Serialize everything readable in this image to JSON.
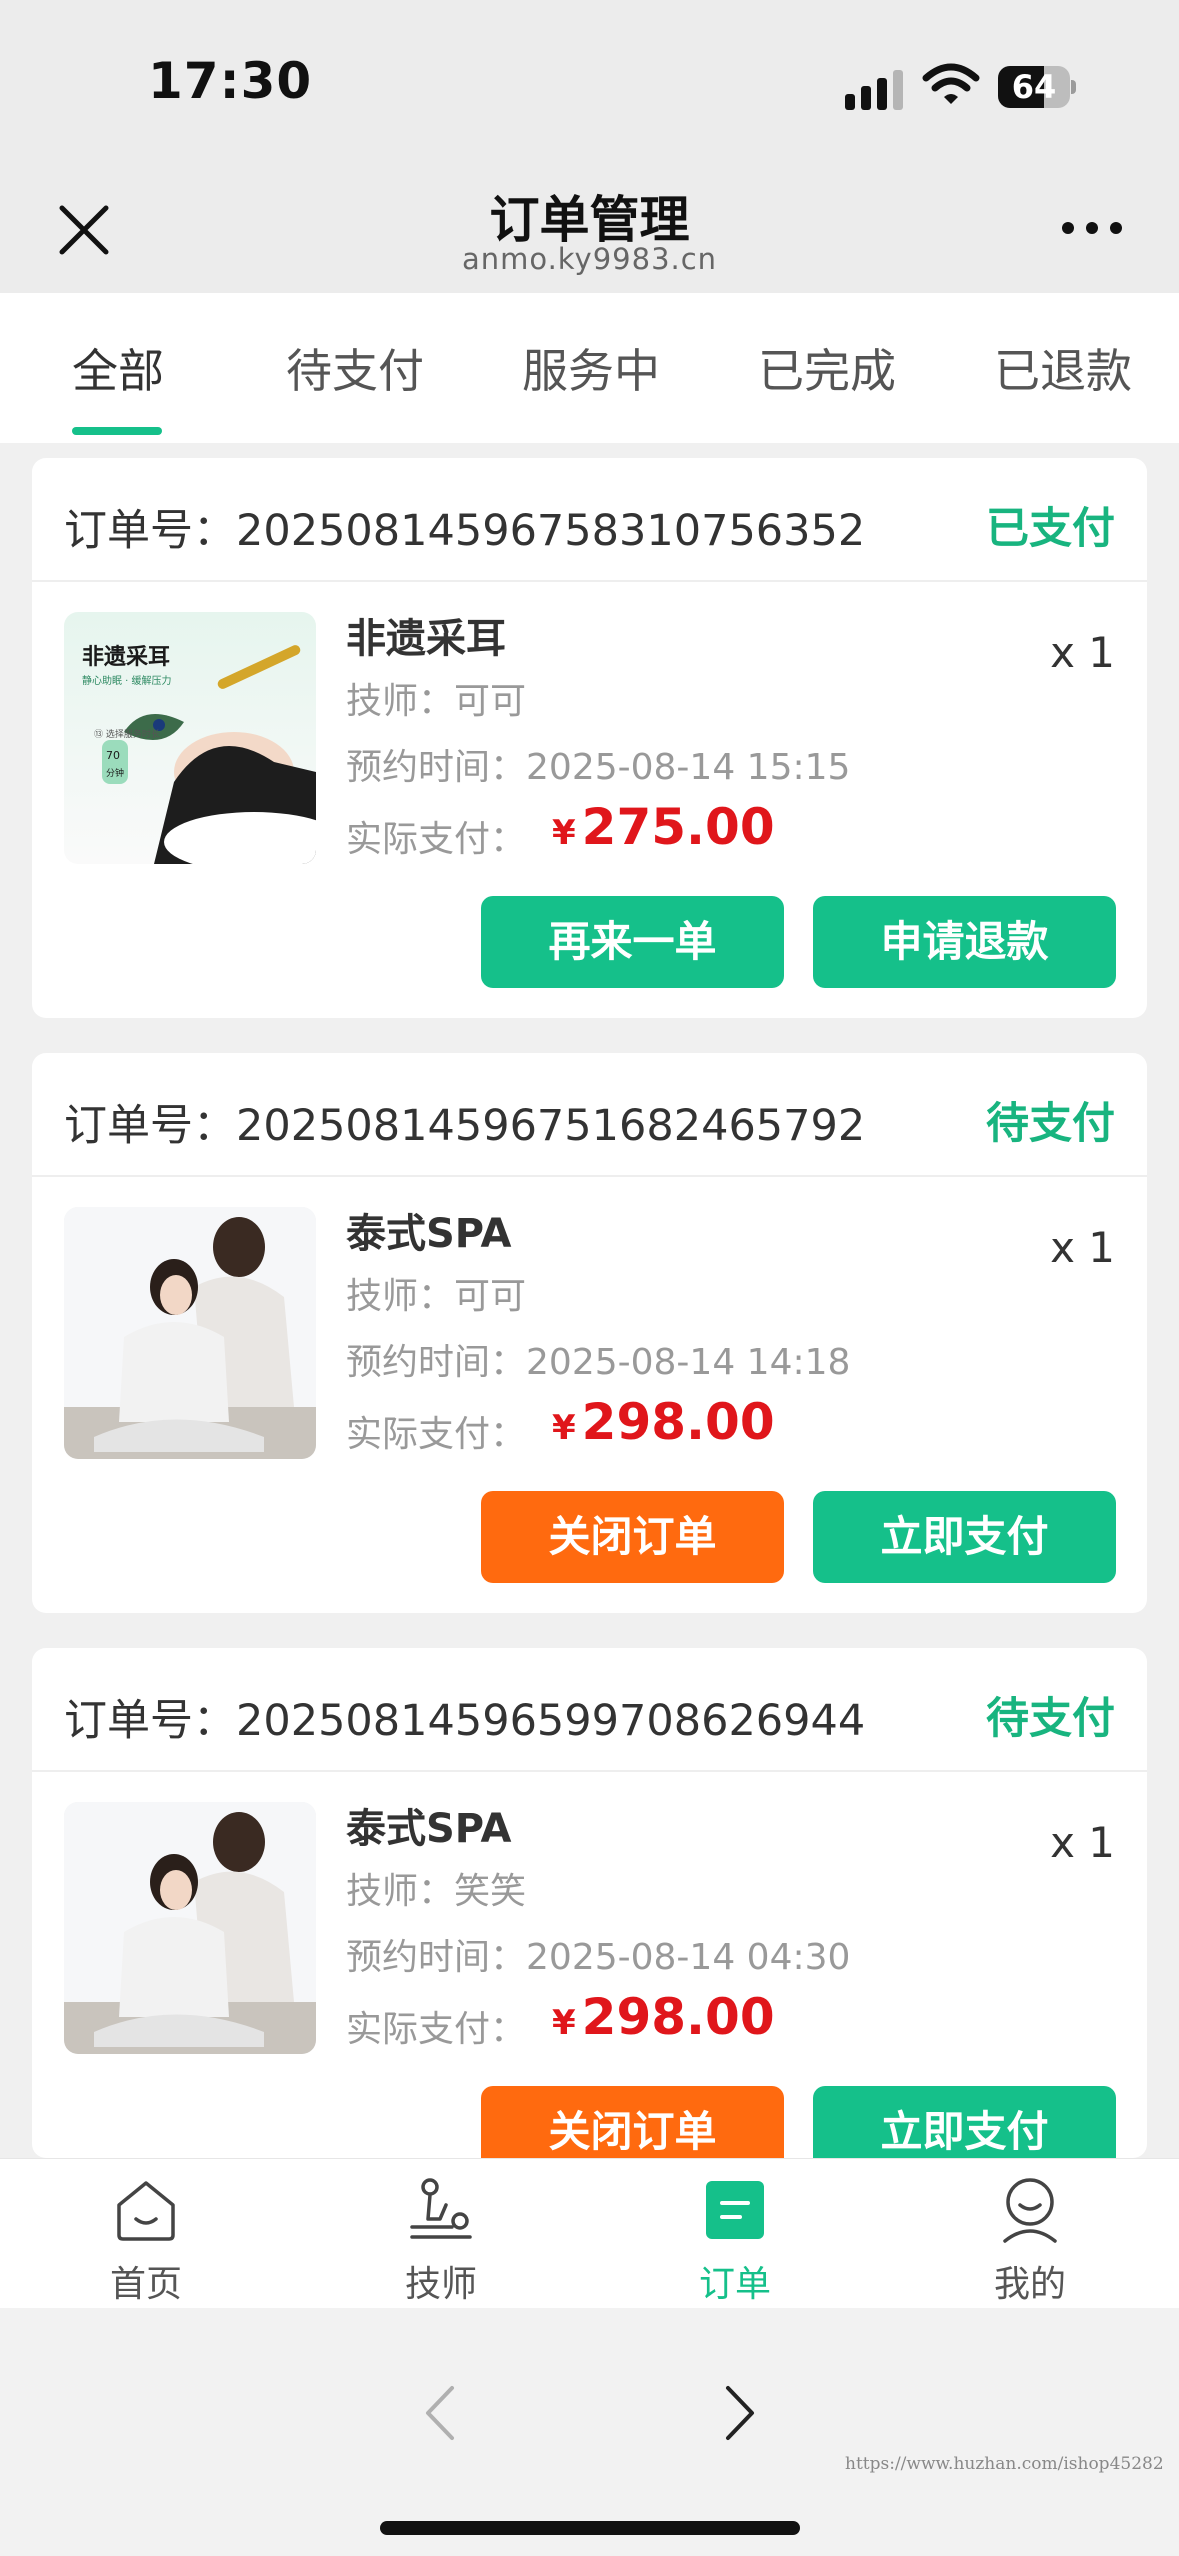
{
  "status_bar": {
    "time": "17:30",
    "battery": "64",
    "battery_level": 0.64
  },
  "header": {
    "title": "订单管理",
    "subtitle": "anmo.ky9983.cn"
  },
  "tabs": [
    {
      "label": "全部",
      "active": true
    },
    {
      "label": "待支付",
      "active": false
    },
    {
      "label": "服务中",
      "active": false
    },
    {
      "label": "已完成",
      "active": false
    },
    {
      "label": "已退款",
      "active": false
    }
  ],
  "orders": [
    {
      "order_label": "订单号：",
      "order_no": "20250814596758310756352",
      "status": "已支付",
      "service": "非遗采耳",
      "qty": "x 1",
      "tech_label": "技师：",
      "tech": "可可",
      "appt_label": "预约时间：",
      "appt_time": "2025-08-14 15:15",
      "paid_label": "实际支付：",
      "currency": "¥",
      "price": "275.00",
      "thumb_text": {
        "title": "非遗采耳",
        "tagline": "静心助眠 · 缓解压力",
        "side": "⑬ 选择服务时长",
        "badge_num": "70",
        "badge_unit": "分钟"
      },
      "buttons": [
        {
          "label": "再来一单",
          "style": "green"
        },
        {
          "label": "申请退款",
          "style": "green"
        }
      ]
    },
    {
      "order_label": "订单号：",
      "order_no": "20250814596751682465792",
      "status": "待支付",
      "service": "泰式SPA",
      "qty": "x 1",
      "tech_label": "技师：",
      "tech": "可可",
      "appt_label": "预约时间：",
      "appt_time": "2025-08-14 14:18",
      "paid_label": "实际支付：",
      "currency": "¥",
      "price": "298.00",
      "buttons": [
        {
          "label": "关闭订单",
          "style": "orange"
        },
        {
          "label": "立即支付",
          "style": "green"
        }
      ]
    },
    {
      "order_label": "订单号：",
      "order_no": "20250814596599708626944",
      "status": "待支付",
      "service": "泰式SPA",
      "qty": "x 1",
      "tech_label": "技师：",
      "tech": "笑笑",
      "appt_label": "预约时间：",
      "appt_time": "2025-08-14 04:30",
      "paid_label": "实际支付：",
      "currency": "¥",
      "price": "298.00",
      "buttons": [
        {
          "label": "关闭订单",
          "style": "orange"
        },
        {
          "label": "立即支付",
          "style": "green"
        }
      ]
    }
  ],
  "bottom_nav": [
    {
      "label": "首页",
      "icon": "home-icon",
      "active": false
    },
    {
      "label": "技师",
      "icon": "technician-icon",
      "active": false
    },
    {
      "label": "订单",
      "icon": "order-icon",
      "active": true
    },
    {
      "label": "我的",
      "icon": "profile-icon",
      "active": false
    }
  ],
  "watermark": "https://www.huzhan.com/ishop45282",
  "colors": {
    "accent": "#15c08a",
    "status_green": "#18b47f",
    "price_red": "#e0161b",
    "orange": "#ff6a0f"
  }
}
